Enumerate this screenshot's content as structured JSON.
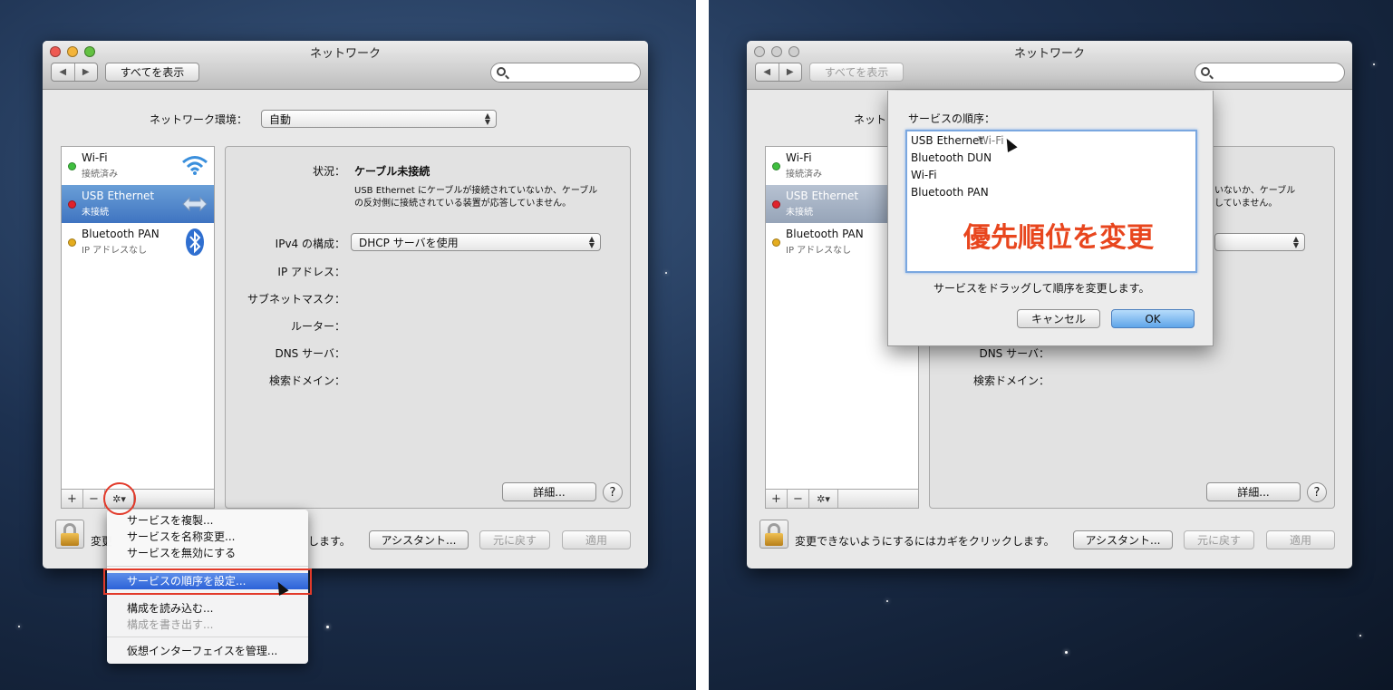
{
  "window_title": "ネットワーク",
  "toolbar": {
    "back": "◀",
    "forward": "▶",
    "show_all": "すべてを表示"
  },
  "location": {
    "label": "ネットワーク環境：",
    "value": "自動"
  },
  "services": [
    {
      "name": "Wi-Fi",
      "status": "接続済み"
    },
    {
      "name": "USB Ethernet",
      "status": "未接続"
    },
    {
      "name": "Bluetooth PAN",
      "status": "IP アドレスなし"
    }
  ],
  "list_footer": {
    "add": "+",
    "remove": "−",
    "gear": "✲▾"
  },
  "detail": {
    "status_label": "状況：",
    "status_value": "ケーブル未接続",
    "status_desc_1": "USB Ethernet にケーブルが接続されていないか、ケーブル",
    "status_desc_2": "の反対側に接続されている装置が応答していません。",
    "ipv4_label": "IPv4 の構成：",
    "ipv4_value": "DHCP サーバを使用",
    "ip_label": "IP アドレス：",
    "subnet_label": "サブネットマスク：",
    "router_label": "ルーター：",
    "dns_label": "DNS サーバ：",
    "search_label": "検索ドメイン：",
    "advanced": "詳細...",
    "help": "?"
  },
  "bottom": {
    "lock_text": "変更できないようにするにはカギをクリックします。",
    "lock_text_partial_a": "変更",
    "lock_text_partial_b": "します。",
    "assistant": "アシスタント...",
    "revert": "元に戻す",
    "apply": "適用"
  },
  "menu": {
    "duplicate": "サービスを複製...",
    "rename": "サービスを名称変更...",
    "disable": "サービスを無効にする",
    "set_order": "サービスの順序を設定...",
    "import": "構成を読み込む...",
    "export": "構成を書き出す...",
    "virtual": "仮想インターフェイスを管理..."
  },
  "order_sheet": {
    "title": "サービスの順序：",
    "items": [
      "USB Ethernet",
      "Bluetooth DUN",
      "Wi-Fi",
      "Bluetooth PAN"
    ],
    "drag_ghost": "Wi-Fi",
    "hint": "サービスをドラッグして順序を変更します。",
    "cancel": "キャンセル",
    "ok": "OK",
    "annotation": "優先順位を変更"
  },
  "colors": {
    "accent": "#3f74c1",
    "highlight_red": "#e23a2a",
    "annotation": "#e8461e"
  }
}
